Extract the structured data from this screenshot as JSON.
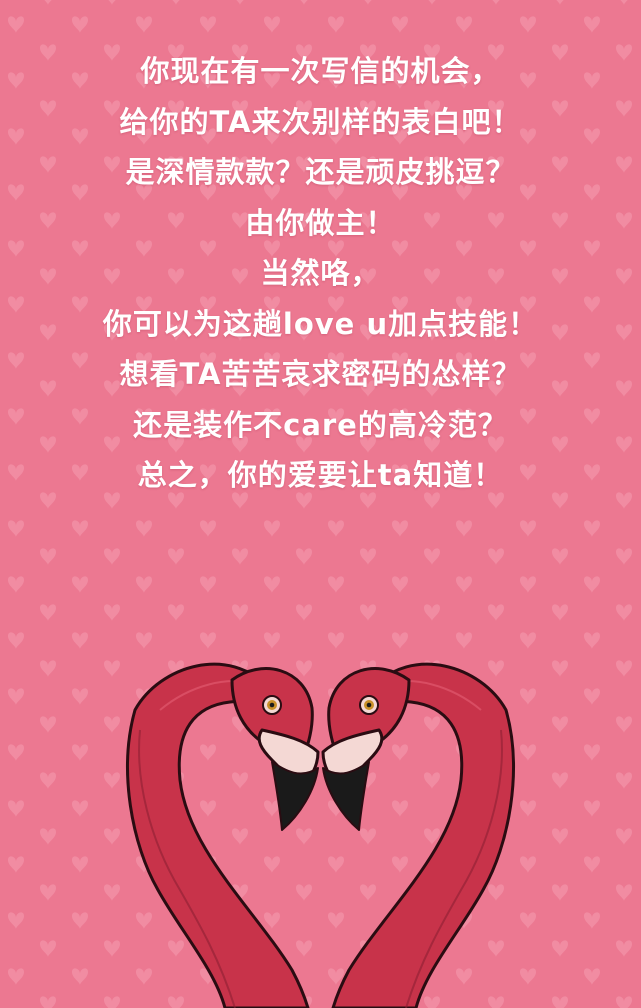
{
  "message": {
    "lines": [
      "你现在有一次写信的机会，",
      "给你的TA来次别样的表白吧！",
      "是深情款款？还是顽皮挑逗？",
      "由你做主！",
      "当然咯，",
      "你可以为这趟love u加点技能！",
      "想看TA苦苦哀求密码的怂样？",
      "还是装作不care的高冷范？",
      "总之，你的爱要让ta知道！"
    ]
  },
  "illustration": {
    "icon": "flamingo-heart-icon"
  },
  "colors": {
    "background": "#ec7891",
    "heart_pattern": "#f293a8",
    "text": "#ffffff",
    "flamingo": "#c8334a",
    "flamingo_shadow": "#8e1f33",
    "beak_pale": "#f4d8d4",
    "beak_tip": "#1a1a1a",
    "outline": "#2a0c12"
  }
}
